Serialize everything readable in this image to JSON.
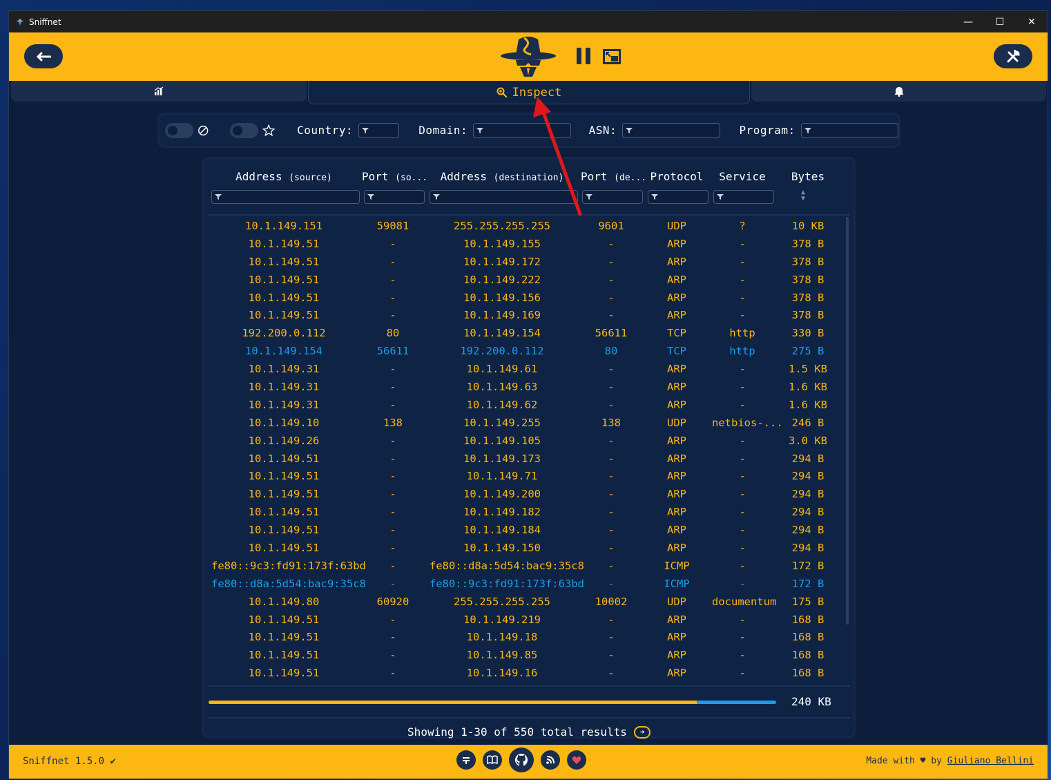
{
  "window": {
    "title": "Sniffnet",
    "minimize": "—",
    "maximize": "☐",
    "close": "✕"
  },
  "tabs": {
    "overview": "",
    "inspect": "Inspect",
    "notifications": ""
  },
  "filters": {
    "country_label": "Country:",
    "domain_label": "Domain:",
    "asn_label": "ASN:",
    "program_label": "Program:"
  },
  "columns": {
    "src_address": "Address",
    "src_address_sub": "(source)",
    "src_port": "Port",
    "src_port_sub": "(so...",
    "dst_address": "Address",
    "dst_address_sub": "(destination)",
    "dst_port": "Port",
    "dst_port_sub": "(de...",
    "protocol": "Protocol",
    "service": "Service",
    "bytes": "Bytes"
  },
  "rows": [
    {
      "src": "10.1.149.151",
      "sport": "59081",
      "dst": "255.255.255.255",
      "dport": "9601",
      "proto": "UDP",
      "svc": "?",
      "bytes": "10 KB",
      "blue": false
    },
    {
      "src": "10.1.149.51",
      "sport": "-",
      "dst": "10.1.149.155",
      "dport": "-",
      "proto": "ARP",
      "svc": "-",
      "bytes": "378 B",
      "blue": false
    },
    {
      "src": "10.1.149.51",
      "sport": "-",
      "dst": "10.1.149.172",
      "dport": "-",
      "proto": "ARP",
      "svc": "-",
      "bytes": "378 B",
      "blue": false
    },
    {
      "src": "10.1.149.51",
      "sport": "-",
      "dst": "10.1.149.222",
      "dport": "-",
      "proto": "ARP",
      "svc": "-",
      "bytes": "378 B",
      "blue": false
    },
    {
      "src": "10.1.149.51",
      "sport": "-",
      "dst": "10.1.149.156",
      "dport": "-",
      "proto": "ARP",
      "svc": "-",
      "bytes": "378 B",
      "blue": false
    },
    {
      "src": "10.1.149.51",
      "sport": "-",
      "dst": "10.1.149.169",
      "dport": "-",
      "proto": "ARP",
      "svc": "-",
      "bytes": "378 B",
      "blue": false
    },
    {
      "src": "192.200.0.112",
      "sport": "80",
      "dst": "10.1.149.154",
      "dport": "56611",
      "proto": "TCP",
      "svc": "http",
      "bytes": "330 B",
      "blue": false
    },
    {
      "src": "10.1.149.154",
      "sport": "56611",
      "dst": "192.200.0.112",
      "dport": "80",
      "proto": "TCP",
      "svc": "http",
      "bytes": "275 B",
      "blue": true
    },
    {
      "src": "10.1.149.31",
      "sport": "-",
      "dst": "10.1.149.61",
      "dport": "-",
      "proto": "ARP",
      "svc": "-",
      "bytes": "1.5 KB",
      "blue": false
    },
    {
      "src": "10.1.149.31",
      "sport": "-",
      "dst": "10.1.149.63",
      "dport": "-",
      "proto": "ARP",
      "svc": "-",
      "bytes": "1.6 KB",
      "blue": false
    },
    {
      "src": "10.1.149.31",
      "sport": "-",
      "dst": "10.1.149.62",
      "dport": "-",
      "proto": "ARP",
      "svc": "-",
      "bytes": "1.6 KB",
      "blue": false
    },
    {
      "src": "10.1.149.10",
      "sport": "138",
      "dst": "10.1.149.255",
      "dport": "138",
      "proto": "UDP",
      "svc": "netbios-...",
      "bytes": "246 B",
      "blue": false
    },
    {
      "src": "10.1.149.26",
      "sport": "-",
      "dst": "10.1.149.105",
      "dport": "-",
      "proto": "ARP",
      "svc": "-",
      "bytes": "3.0 KB",
      "blue": false
    },
    {
      "src": "10.1.149.51",
      "sport": "-",
      "dst": "10.1.149.173",
      "dport": "-",
      "proto": "ARP",
      "svc": "-",
      "bytes": "294 B",
      "blue": false
    },
    {
      "src": "10.1.149.51",
      "sport": "-",
      "dst": "10.1.149.71",
      "dport": "-",
      "proto": "ARP",
      "svc": "-",
      "bytes": "294 B",
      "blue": false
    },
    {
      "src": "10.1.149.51",
      "sport": "-",
      "dst": "10.1.149.200",
      "dport": "-",
      "proto": "ARP",
      "svc": "-",
      "bytes": "294 B",
      "blue": false
    },
    {
      "src": "10.1.149.51",
      "sport": "-",
      "dst": "10.1.149.182",
      "dport": "-",
      "proto": "ARP",
      "svc": "-",
      "bytes": "294 B",
      "blue": false
    },
    {
      "src": "10.1.149.51",
      "sport": "-",
      "dst": "10.1.149.184",
      "dport": "-",
      "proto": "ARP",
      "svc": "-",
      "bytes": "294 B",
      "blue": false
    },
    {
      "src": "10.1.149.51",
      "sport": "-",
      "dst": "10.1.149.150",
      "dport": "-",
      "proto": "ARP",
      "svc": "-",
      "bytes": "294 B",
      "blue": false
    },
    {
      "src": "fe80::9c3:fd91:173f:63bd",
      "sport": "-",
      "dst": "fe80::d8a:5d54:bac9:35c8",
      "dport": "-",
      "proto": "ICMP",
      "svc": "-",
      "bytes": "172 B",
      "blue": false
    },
    {
      "src": "fe80::d8a:5d54:bac9:35c8",
      "sport": "-",
      "dst": "fe80::9c3:fd91:173f:63bd",
      "dport": "-",
      "proto": "ICMP",
      "svc": "-",
      "bytes": "172 B",
      "blue": true
    },
    {
      "src": "10.1.149.80",
      "sport": "60920",
      "dst": "255.255.255.255",
      "dport": "10002",
      "proto": "UDP",
      "svc": "documentum",
      "bytes": "175 B",
      "blue": false
    },
    {
      "src": "10.1.149.51",
      "sport": "-",
      "dst": "10.1.149.219",
      "dport": "-",
      "proto": "ARP",
      "svc": "-",
      "bytes": "168 B",
      "blue": false
    },
    {
      "src": "10.1.149.51",
      "sport": "-",
      "dst": "10.1.149.18",
      "dport": "-",
      "proto": "ARP",
      "svc": "-",
      "bytes": "168 B",
      "blue": false
    },
    {
      "src": "10.1.149.51",
      "sport": "-",
      "dst": "10.1.149.85",
      "dport": "-",
      "proto": "ARP",
      "svc": "-",
      "bytes": "168 B",
      "blue": false
    },
    {
      "src": "10.1.149.51",
      "sport": "-",
      "dst": "10.1.149.16",
      "dport": "-",
      "proto": "ARP",
      "svc": "-",
      "bytes": "168 B",
      "blue": false
    }
  ],
  "totals": {
    "value": "240 KB",
    "incoming_fraction": 0.86
  },
  "pager": {
    "text": "Showing 1-30 of 550 total results",
    "next": "➜"
  },
  "footer": {
    "version": "Sniffnet 1.5.0",
    "version_check": "✔",
    "made_with": "Made with",
    "heart": "♥",
    "by": "by",
    "author": "Giuliano Bellini"
  },
  "colors": {
    "accent": "#fcb712",
    "outgoing": "#1e9ce8",
    "background": "#0d1e3d",
    "button": "#1a2d4d"
  }
}
